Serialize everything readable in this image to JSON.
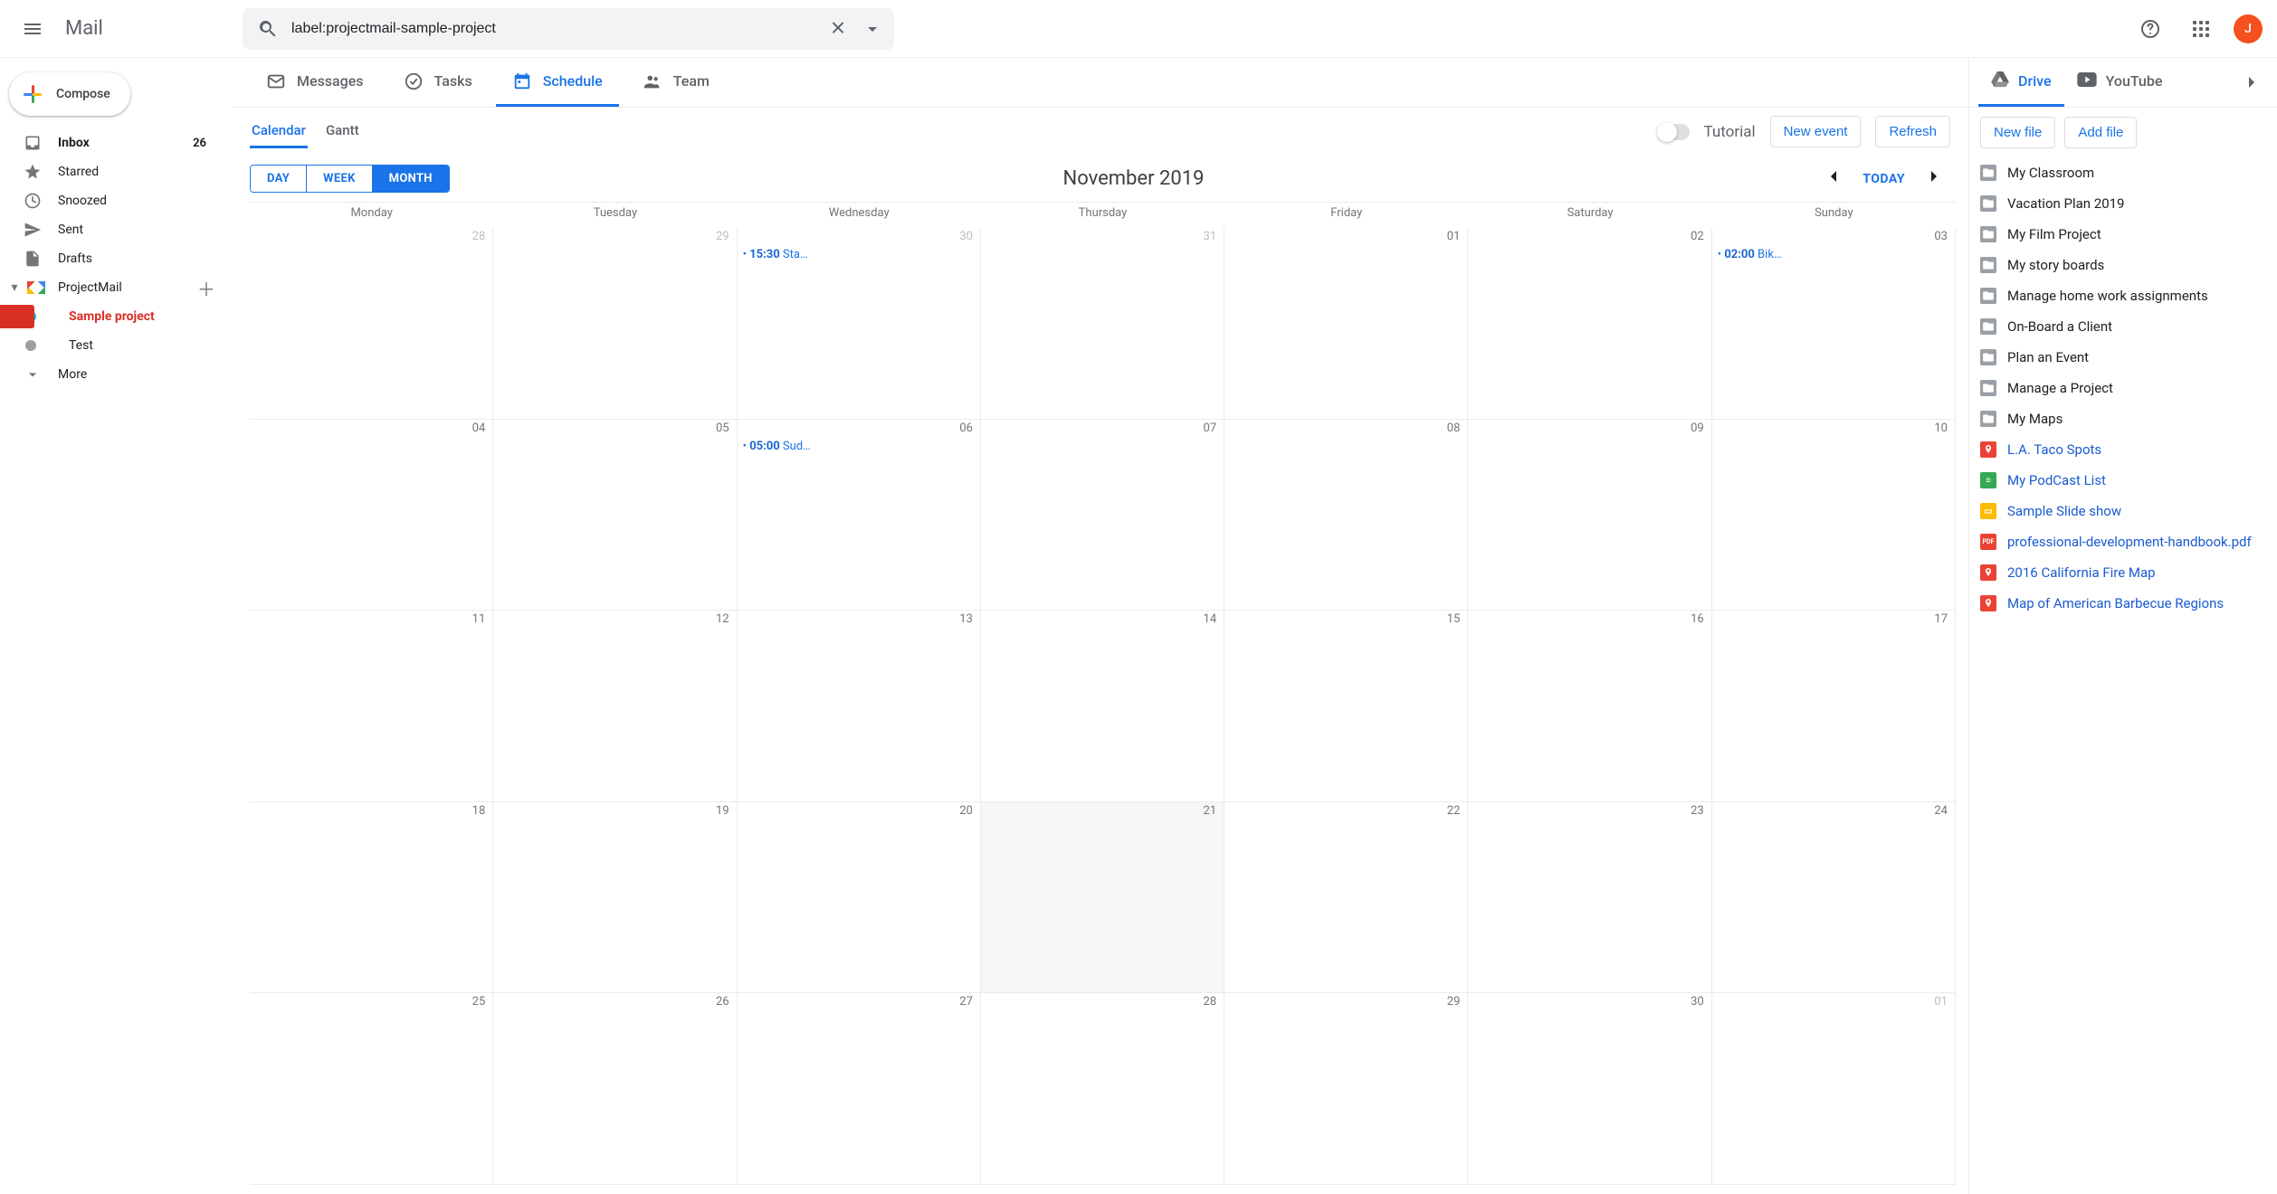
{
  "header": {
    "product": "Mail",
    "search_value": "label:projectmail-sample-project",
    "avatar_initial": "J"
  },
  "sidebar": {
    "compose": "Compose",
    "items": [
      {
        "id": "inbox",
        "label": "Inbox",
        "count": "26",
        "bold": true
      },
      {
        "id": "starred",
        "label": "Starred"
      },
      {
        "id": "snoozed",
        "label": "Snoozed"
      },
      {
        "id": "sent",
        "label": "Sent"
      },
      {
        "id": "drafts",
        "label": "Drafts"
      }
    ],
    "projectmail": "ProjectMail",
    "projects": [
      {
        "label": "Sample project",
        "color": "#00bcd4",
        "selected": true
      },
      {
        "label": "Test",
        "color": "#9e9e9e"
      }
    ],
    "more": "More"
  },
  "tabs": {
    "messages": "Messages",
    "tasks": "Tasks",
    "schedule": "Schedule",
    "team": "Team"
  },
  "schedule": {
    "sub_calendar": "Calendar",
    "sub_gantt": "Gantt",
    "tutorial": "Tutorial",
    "new_event": "New event",
    "refresh": "Refresh",
    "views": {
      "day": "DAY",
      "week": "WEEK",
      "month": "MONTH"
    },
    "month_title": "November 2019",
    "today": "TODAY",
    "dow": [
      "Monday",
      "Tuesday",
      "Wednesday",
      "Thursday",
      "Friday",
      "Saturday",
      "Sunday"
    ],
    "cells": [
      {
        "n": "28",
        "other": true
      },
      {
        "n": "29",
        "other": true
      },
      {
        "n": "30",
        "other": true,
        "evt": {
          "time": "15:30",
          "title": "Sta…"
        }
      },
      {
        "n": "31",
        "other": true
      },
      {
        "n": "01"
      },
      {
        "n": "02"
      },
      {
        "n": "03",
        "evt": {
          "time": "02:00",
          "title": "Bik…"
        }
      },
      {
        "n": "04"
      },
      {
        "n": "05"
      },
      {
        "n": "06",
        "evt": {
          "time": "05:00",
          "title": "Sud…"
        }
      },
      {
        "n": "07"
      },
      {
        "n": "08"
      },
      {
        "n": "09"
      },
      {
        "n": "10"
      },
      {
        "n": "11"
      },
      {
        "n": "12"
      },
      {
        "n": "13"
      },
      {
        "n": "14"
      },
      {
        "n": "15"
      },
      {
        "n": "16"
      },
      {
        "n": "17"
      },
      {
        "n": "18"
      },
      {
        "n": "19"
      },
      {
        "n": "20"
      },
      {
        "n": "21",
        "today": true
      },
      {
        "n": "22"
      },
      {
        "n": "23"
      },
      {
        "n": "24"
      },
      {
        "n": "25"
      },
      {
        "n": "26"
      },
      {
        "n": "27"
      },
      {
        "n": "28"
      },
      {
        "n": "29"
      },
      {
        "n": "30"
      },
      {
        "n": "01",
        "other": true
      }
    ]
  },
  "right": {
    "drive": "Drive",
    "youtube": "YouTube",
    "new_file": "New file",
    "add_file": "Add file",
    "files": [
      {
        "type": "folder",
        "name": "My Classroom"
      },
      {
        "type": "folder",
        "name": "Vacation Plan 2019"
      },
      {
        "type": "folder",
        "name": "My Film Project"
      },
      {
        "type": "folder",
        "name": "My story boards"
      },
      {
        "type": "folder",
        "name": "Manage home work assignments"
      },
      {
        "type": "folder",
        "name": "On-Board a Client"
      },
      {
        "type": "folder",
        "name": "Plan an Event"
      },
      {
        "type": "folder",
        "name": "Manage a Project"
      },
      {
        "type": "folder",
        "name": "My Maps"
      },
      {
        "type": "map",
        "name": "L.A. Taco Spots",
        "link": true
      },
      {
        "type": "sheet",
        "name": "My PodCast List",
        "link": true
      },
      {
        "type": "slide",
        "name": "Sample Slide show",
        "link": true
      },
      {
        "type": "pdf",
        "name": "professional-development-handbook.pdf",
        "link": true
      },
      {
        "type": "map",
        "name": "2016 California Fire Map",
        "link": true
      },
      {
        "type": "map",
        "name": "Map of American Barbecue Regions",
        "link": true
      }
    ]
  }
}
